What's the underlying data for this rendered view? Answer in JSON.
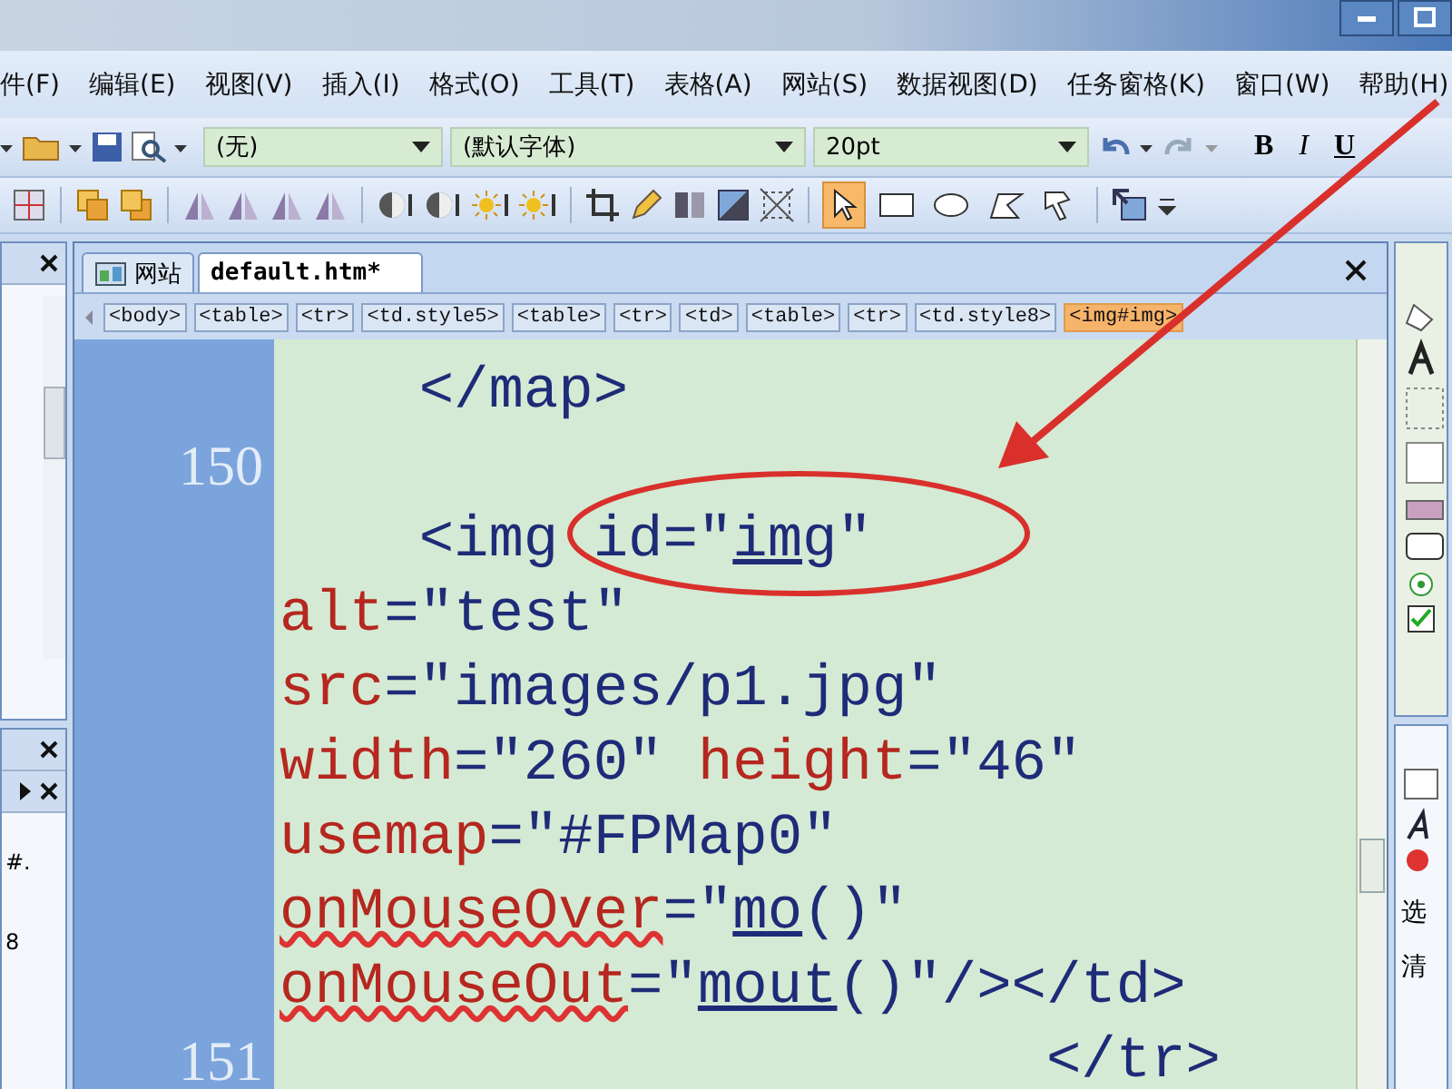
{
  "menu": [
    "件(F)",
    "编辑(E)",
    "视图(V)",
    "插入(I)",
    "格式(O)",
    "工具(T)",
    "表格(A)",
    "网站(S)",
    "数据视图(D)",
    "任务窗格(K)",
    "窗口(W)",
    "帮助(H)"
  ],
  "format_bar": {
    "style": "(无)",
    "font": "(默认字体)",
    "size": "20pt",
    "bold": "B",
    "italic": "I",
    "underline": "U"
  },
  "drawing_tools": [
    {
      "kind": "pointer",
      "selected": true
    },
    {
      "kind": "rectangle",
      "selected": false
    },
    {
      "kind": "ellipse",
      "selected": false
    },
    {
      "kind": "polygon",
      "selected": false
    },
    {
      "kind": "callout",
      "selected": false
    }
  ],
  "tabs": [
    {
      "label": "网站",
      "selected": false
    },
    {
      "label": "default.htm*",
      "selected": true
    }
  ],
  "breadcrumb": [
    {
      "label": "<body>",
      "selected": false
    },
    {
      "label": "<table>",
      "selected": false
    },
    {
      "label": "<tr>",
      "selected": false
    },
    {
      "label": "<td.style5>",
      "selected": false
    },
    {
      "label": "<table>",
      "selected": false
    },
    {
      "label": "<tr>",
      "selected": false
    },
    {
      "label": "<td>",
      "selected": false
    },
    {
      "label": "<table>",
      "selected": false
    },
    {
      "label": "<tr>",
      "selected": false
    },
    {
      "label": "<td.style8>",
      "selected": false
    },
    {
      "label": "<img#img>",
      "selected": true
    }
  ],
  "code_lines": [
    {
      "tokens": [
        {
          "kind": "tag",
          "text": "    </map>"
        }
      ]
    },
    {
      "number": "150"
    },
    {
      "tokens": [
        {
          "kind": "tag",
          "text": "    <img "
        },
        {
          "kind": "value",
          "text": "id=\""
        },
        {
          "kind": "link",
          "text": "img"
        },
        {
          "kind": "value",
          "text": "\""
        }
      ]
    },
    {
      "tokens": [
        {
          "kind": "attr",
          "text": "alt"
        },
        {
          "kind": "value",
          "text": "=\"test\""
        }
      ]
    },
    {
      "tokens": [
        {
          "kind": "attr",
          "text": "src"
        },
        {
          "kind": "value",
          "text": "=\"images/p1.jpg\""
        }
      ]
    },
    {
      "tokens": [
        {
          "kind": "attr",
          "text": "width"
        },
        {
          "kind": "value",
          "text": "=\"260\" "
        },
        {
          "kind": "attr",
          "text": "height"
        },
        {
          "kind": "value",
          "text": "=\"46\""
        }
      ]
    },
    {
      "tokens": [
        {
          "kind": "attr",
          "text": "usemap"
        },
        {
          "kind": "value",
          "text": "=\"#FPMap0\""
        }
      ]
    },
    {
      "tokens": [
        {
          "kind": "error",
          "text": "onMouseOver"
        },
        {
          "kind": "value",
          "text": "=\""
        },
        {
          "kind": "link",
          "text": "mo"
        },
        {
          "kind": "value",
          "text": "()\""
        }
      ]
    },
    {
      "tokens": [
        {
          "kind": "error",
          "text": "onMouseOut"
        },
        {
          "kind": "value",
          "text": "=\""
        },
        {
          "kind": "link",
          "text": "mout"
        },
        {
          "kind": "value",
          "text": "()\"/></td>"
        }
      ]
    },
    {
      "number": "151",
      "tokens": [
        {
          "kind": "tag",
          "text": "                      </tr>"
        }
      ]
    }
  ],
  "left_panel": {
    "fragments": [
      "#.",
      "8"
    ]
  },
  "right_panel": {
    "fragments": [
      "选",
      "清"
    ]
  },
  "annotation": {
    "color": "#d9302c"
  }
}
